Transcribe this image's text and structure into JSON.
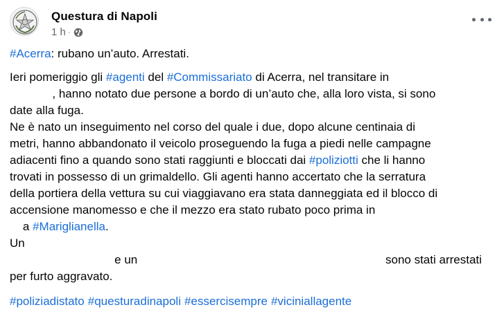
{
  "post": {
    "page_name": "Questura di Napoli",
    "timestamp": "1 h",
    "separator": "·",
    "privacy_icon": "globe-icon",
    "more_icon": "more-options-icon",
    "avatar": "police-emblem",
    "colors": {
      "hashtag": "#1a6ed8",
      "meta": "#65676b",
      "text": "#050505"
    }
  },
  "content": {
    "title_hashtag": "#Acerra",
    "title_text": ": rubano un’auto. Arrestati.",
    "l1_a": "Ieri pomeriggio gli ",
    "l1_tag1": "#agenti",
    "l1_b": " del ",
    "l1_tag2": "#Commissariato",
    "l1_c": " di Acerra, nel transitare in",
    "l2": "             , hanno notato due persone a bordo di un’auto che, alla loro vista, si sono",
    "l3": "date alla fuga.",
    "l4": "Ne è nato un inseguimento nel corso del quale i due, dopo alcune centinaia di",
    "l5": "metri, hanno abbandonato il veicolo proseguendo la fuga a piedi nelle campagne",
    "l6_a": "adiacenti fino a quando sono stati raggiunti e bloccati dai ",
    "l6_tag": "#poliziotti",
    "l6_b": " che li hanno",
    "l7": "trovati in possesso di un grimaldello. Gli agenti hanno accertato che la serratura",
    "l8": "della portiera della vettura su cui viaggiavano era stata danneggiata ed il blocco di",
    "l9": "accensione manomesso e che il mezzo era stato rubato poco prima in",
    "l10_a": "    a ",
    "l10_tag": "#Mariglianella",
    "l10_b": ".",
    "l11": "Un",
    "l12_a": "                                e un",
    "l12_b": "sono stati arrestati",
    "l13": "per furto aggravato.",
    "tags": [
      "#poliziadistato",
      "#questuradinapoli",
      "#essercisempre",
      "#vicinialla gente"
    ]
  }
}
